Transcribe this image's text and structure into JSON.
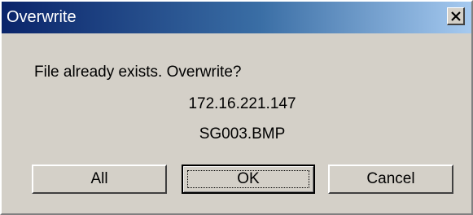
{
  "window": {
    "title": "Overwrite",
    "close_label": "close",
    "title_gradient_start": "#0a246a",
    "title_gradient_end": "#a6caf0",
    "face_color": "#d4d0c8"
  },
  "body": {
    "message": "File already exists. Overwrite?",
    "host": "172.16.221.147",
    "filename": "SG003.BMP"
  },
  "buttons": {
    "all_label": "All",
    "ok_label": "OK",
    "cancel_label": "Cancel",
    "default": "OK"
  }
}
